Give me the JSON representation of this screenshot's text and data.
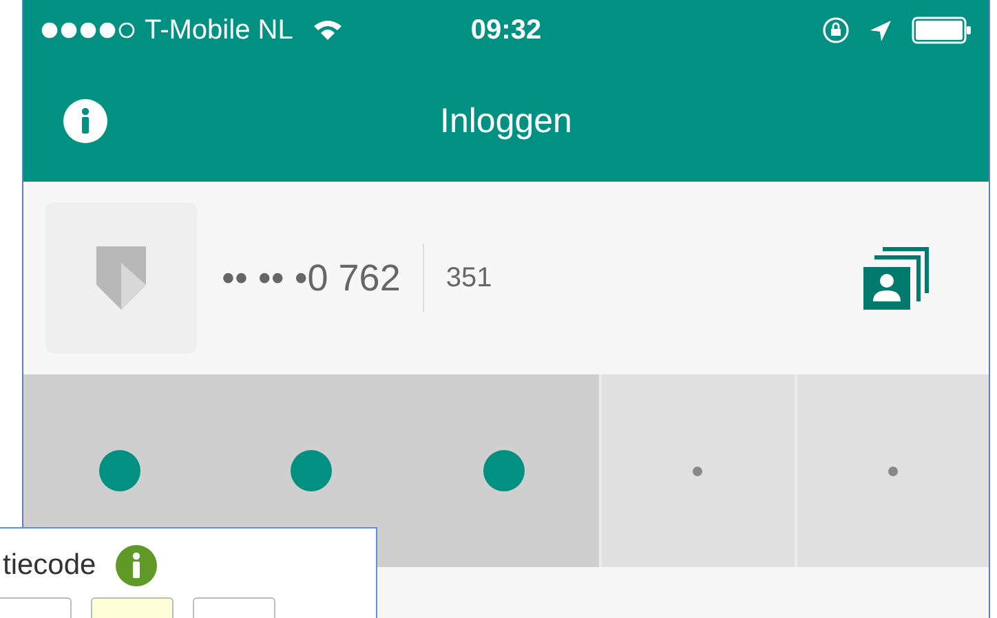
{
  "status_bar": {
    "carrier": "T-Mobile NL",
    "time": "09:32"
  },
  "nav_bar": {
    "title": "Inloggen"
  },
  "account": {
    "number": "•• •• •0 762",
    "code": "351"
  },
  "pin_cells": [
    {
      "filled": true
    },
    {
      "filled": true
    },
    {
      "filled": true
    },
    {
      "filled": false
    },
    {
      "filled": false
    }
  ],
  "overlay": {
    "label": "tiecode",
    "fields": [
      {
        "selected": false
      },
      {
        "selected": true
      },
      {
        "selected": false
      }
    ]
  }
}
